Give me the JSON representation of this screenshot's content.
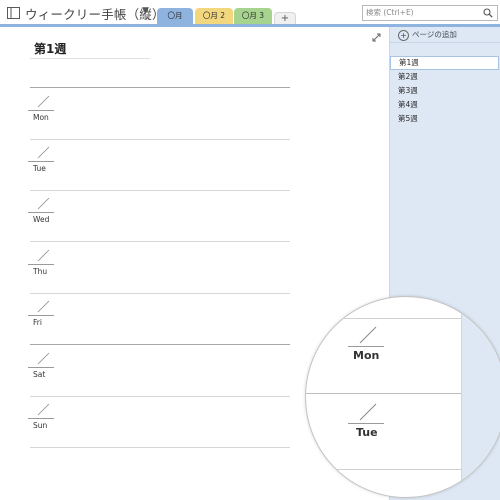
{
  "notebook": {
    "title": "ウィークリー手帳（縦）",
    "icon": "notebook-icon",
    "dropdown_icon": "caret-down-icon"
  },
  "tabs": [
    {
      "label": "〇月",
      "color": "#8fb3df",
      "active": true
    },
    {
      "label": "〇月 2",
      "color": "#f3d77e"
    },
    {
      "label": "〇月 3",
      "color": "#a6d48e"
    }
  ],
  "add_tab_label": "+",
  "search": {
    "placeholder": "検索 (Ctrl+E)",
    "icon": "search-icon"
  },
  "page": {
    "title": "第1週",
    "days": [
      "Mon",
      "Tue",
      "Wed",
      "Thu",
      "Fri",
      "Sat",
      "Sun"
    ],
    "expand_icon": "expand-icon"
  },
  "sidebar": {
    "add_page_label": "ページの追加",
    "add_page_icon": "plus-circle-icon",
    "pages": [
      {
        "label": "第1週",
        "selected": true
      },
      {
        "label": "第2週"
      },
      {
        "label": "第3週"
      },
      {
        "label": "第4週"
      },
      {
        "label": "第5週"
      }
    ]
  },
  "magnifier": {
    "days": [
      "Mon",
      "Tue"
    ]
  }
}
